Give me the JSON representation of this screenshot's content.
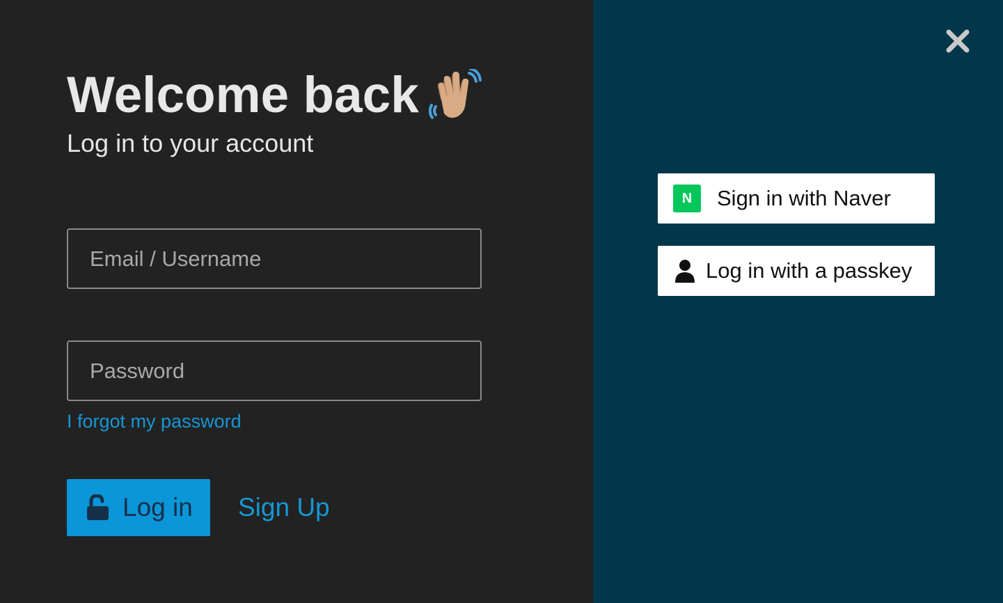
{
  "login": {
    "title": "Welcome back",
    "subtitle": "Log in to your account",
    "email_placeholder": "Email / Username",
    "password_placeholder": "Password",
    "forgot_label": "I forgot my password",
    "login_label": "Log in",
    "signup_label": "Sign Up"
  },
  "social": {
    "naver_icon_letter": "N",
    "naver_label": "Sign in with Naver",
    "passkey_label": "Log in with a passkey"
  },
  "icons": {
    "title_icon": "waving-hand-icon",
    "login_icon": "unlocked-padlock-icon",
    "close_icon": "close-icon",
    "naver_icon": "naver-logo-icon",
    "passkey_icon": "user-icon"
  },
  "colors": {
    "left_bg": "#222222",
    "right_bg": "#02364b",
    "accent": "#0a96d8",
    "link": "#1597d4",
    "naver_green": "#03c75a"
  }
}
